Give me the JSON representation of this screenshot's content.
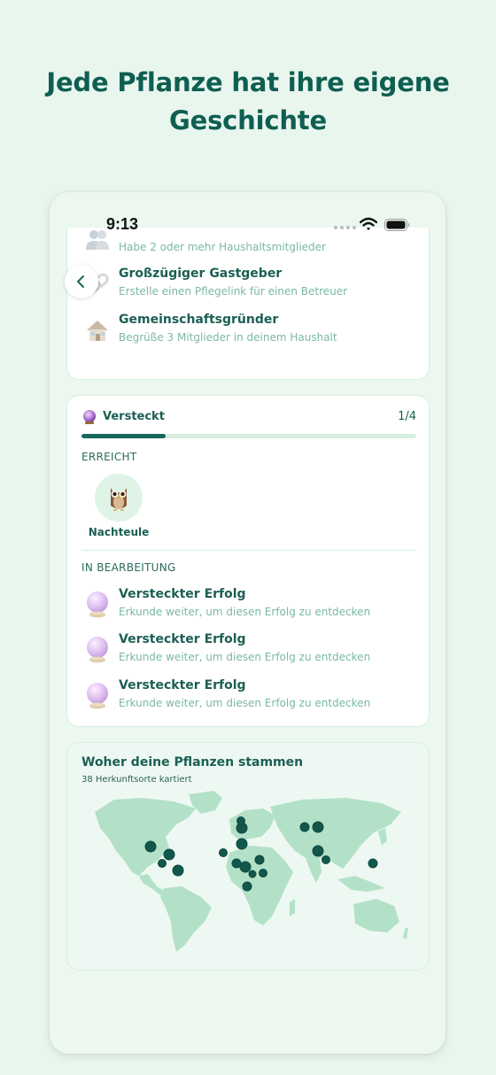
{
  "headline": [
    "Jede Pflanze hat ihre eigene",
    "Geschichte"
  ],
  "status_bar": {
    "time": "9:13"
  },
  "household_achievements": [
    {
      "icon": "people-icon",
      "title": "",
      "desc": "Habe 2 oder mehr Haushaltsmitglieder"
    },
    {
      "icon": "chain-link-icon",
      "title": "Großzügiger Gastgeber",
      "desc": "Erstelle einen Pflegelink für einen Betreuer"
    },
    {
      "icon": "house-icon",
      "title": "Gemeinschaftsgründer",
      "desc": "Begrüße 3 Mitglieder in deinem Haushalt"
    }
  ],
  "hidden_category": {
    "icon": "crystal-ball-icon",
    "title": "Versteckt",
    "count": "1/4",
    "progress": 0.25,
    "achieved_label": "ERREICHT",
    "achieved": [
      {
        "icon": "owl-icon",
        "label": "Nachteule"
      }
    ],
    "in_progress_label": "IN BEARBEITUNG",
    "in_progress": [
      {
        "icon": "crystal-ball-icon",
        "title": "Versteckter Erfolg",
        "desc": "Erkunde weiter, um diesen Erfolg zu entdecken"
      },
      {
        "icon": "crystal-ball-icon",
        "title": "Versteckter Erfolg",
        "desc": "Erkunde weiter, um diesen Erfolg zu entdecken"
      },
      {
        "icon": "crystal-ball-icon",
        "title": "Versteckter Erfolg",
        "desc": "Erkunde weiter, um diesen Erfolg zu entdecken"
      }
    ]
  },
  "origins_map": {
    "title": "Woher deine Pflanzen stammen",
    "subtitle": "38 Herkunftsorte kartiert"
  },
  "colors": {
    "background": "#e8f6ee",
    "accent": "#0f5e52",
    "muted_text": "#7ab8a7",
    "map_land": "#b3e1c8",
    "map_marker": "#13564c"
  }
}
